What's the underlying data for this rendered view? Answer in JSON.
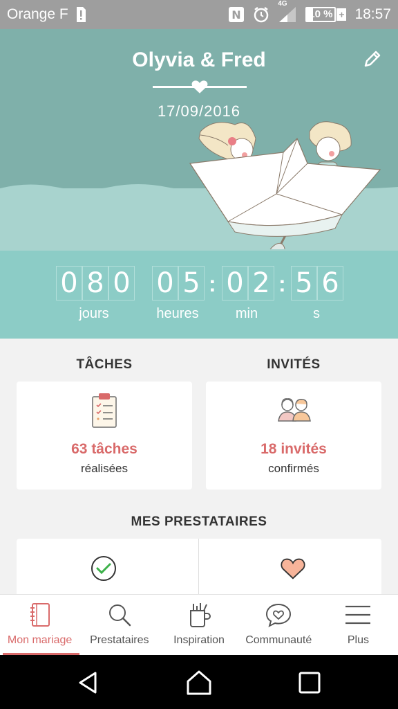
{
  "status_bar": {
    "carrier": "Orange F",
    "network": "4G",
    "battery": "10 %",
    "battery_level": 0.1,
    "time": "18:57",
    "icons": [
      "sim-alert-icon",
      "nfc-icon",
      "alarm-icon",
      "signal-icon",
      "battery-icon"
    ]
  },
  "header": {
    "couple": "Olyvia & Fred",
    "date": "17/09/2016",
    "colors": {
      "sky": "#7fb0aa",
      "water": "#a8d3ce",
      "countdown": "#8cccc6",
      "accent": "#d96a6a"
    }
  },
  "countdown": {
    "days": [
      "0",
      "8",
      "0"
    ],
    "hours": [
      "0",
      "5"
    ],
    "minutes": [
      "0",
      "2"
    ],
    "seconds": [
      "5",
      "6"
    ],
    "labels": {
      "days": "jours",
      "hours": "heures",
      "minutes": "min",
      "seconds": "s"
    }
  },
  "tasks": {
    "title": "TÂCHES",
    "value": "63 tâches",
    "label": "réalisées"
  },
  "guests": {
    "title": "INVITÉS",
    "value": "18 invités",
    "label": "confirmés"
  },
  "vendors": {
    "title": "MES PRESTATAIRES"
  },
  "bottom_nav": {
    "items": [
      {
        "label": "Mon mariage",
        "icon": "notebook-icon",
        "active": true
      },
      {
        "label": "Prestataires",
        "icon": "search-icon",
        "active": false
      },
      {
        "label": "Inspiration",
        "icon": "inspiration-cup-icon",
        "active": false
      },
      {
        "label": "Communauté",
        "icon": "chat-heart-icon",
        "active": false
      },
      {
        "label": "Plus",
        "icon": "menu-icon",
        "active": false
      }
    ]
  }
}
